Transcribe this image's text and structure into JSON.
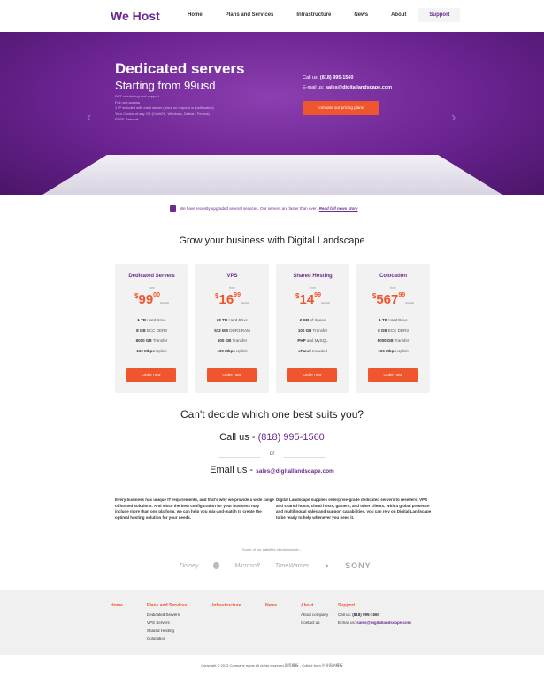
{
  "header": {
    "logo": "We Host",
    "nav": [
      "Home",
      "Plans and Services",
      "Infrastructure",
      "News",
      "About",
      "Support"
    ]
  },
  "hero": {
    "title": "Dedicated servers",
    "subtitle": "Starting from 99usd",
    "features": [
      "24/7 monitoring and support",
      "Full root access",
      "1 IP included with each server (more on request or justification)",
      "Your Choice of any OS (CentOS, Windows, Debian, Fedora)",
      "FREE Reboots"
    ],
    "call_label": "Call us:",
    "call_number": "(818) 995-1560",
    "email_label": "E-mail us:",
    "email": "sales@digitallandscape.com",
    "button": "compare our pricing plans"
  },
  "notice": {
    "text": "We have recently upgraded several services. Our servers are faster than ever.",
    "link": "Read full news story"
  },
  "section_title": "Grow your business with Digital Landscape",
  "plans": [
    {
      "name": "Dedicated Servers",
      "from": "from",
      "currency": "$",
      "int": "99",
      "dec": "00",
      "per": "/month",
      "features": [
        [
          "1 TB",
          "Hard Drive"
        ],
        [
          "8 GB",
          "ECC DDR3"
        ],
        [
          "6000 GB",
          "Transfer"
        ],
        [
          "100 Mbps",
          "Uplink"
        ]
      ],
      "button": "Order now"
    },
    {
      "name": "VPS",
      "from": "from",
      "currency": "$",
      "int": "16",
      "dec": "99",
      "per": "/month",
      "features": [
        [
          "20 TB",
          "Hard Drive"
        ],
        [
          "512 MB",
          "DDR3 RAM"
        ],
        [
          "500 GB",
          "Transfer"
        ],
        [
          "100 Mbps",
          "Uplink"
        ]
      ],
      "button": "Order now"
    },
    {
      "name": "Shared Hosting",
      "from": "from",
      "currency": "$",
      "int": "14",
      "dec": "99",
      "per": "/month",
      "features": [
        [
          "2 GB",
          "of Space"
        ],
        [
          "100 GB",
          "Transfer"
        ],
        [
          "PHP",
          "and MySQL"
        ],
        [
          "cPanel",
          "Included"
        ]
      ],
      "button": "Order now"
    },
    {
      "name": "Colocation",
      "from": "from",
      "currency": "$",
      "int": "567",
      "dec": "99",
      "per": "/month",
      "features": [
        [
          "1 TB",
          "Hard Drive"
        ],
        [
          "8 GB",
          "ECC DDR3"
        ],
        [
          "6000 GB",
          "Transfer"
        ],
        [
          "100 Mbps",
          "Uplink"
        ]
      ],
      "button": "Order now"
    }
  ],
  "cta": {
    "title": "Can't decide which one best suits you?",
    "call_label": "Call us -",
    "phone": "(818) 995-1560",
    "or": "or",
    "email_label": "Email us -",
    "email": "sales@digitallandscape.com"
  },
  "columns": {
    "left": "Every business has unique IT requirements, and that's why we provide a wide range of hosted solutions. And since the best configuration for your business may include more than one platform, we can help you mix-and-match to create the optimal hosting solution for your needs.",
    "right": "Digital Landscape supplies enterprise-grade dedicated servers to resellers, VPS and shared hosts, cloud hosts, gamers, and other clients. With a global presence and multilingual sales and support capabilities, you can rely on Digital Landscape to be ready to help whenever you need it."
  },
  "clients": {
    "label": "Some of our satisfied clients include...",
    "logos": [
      "Disney",
      "Microsoft",
      "TimeWarner",
      "SONY"
    ]
  },
  "footer": {
    "home": "Home",
    "plans": "Plans and Services",
    "plans_links": [
      "Dedicated Servers",
      "VPS Servers",
      "Shared Hosting",
      "Colocation"
    ],
    "infrastructure": "Infrastructure",
    "news": "News",
    "about": "About",
    "about_links": [
      "About company",
      "Contact us"
    ],
    "support": "Support",
    "support_call": "Call us:",
    "support_phone": "(818) 995-1560",
    "support_email_label": "E-mail us:",
    "support_email": "sales@digitallandscape.com",
    "copyright": "Copyright © 2013 Company name All rights reserved.网页模板 - Collect from 企业网站模板"
  },
  "colors": {
    "purple": "#6b2a8e",
    "orange": "#f0562d"
  }
}
